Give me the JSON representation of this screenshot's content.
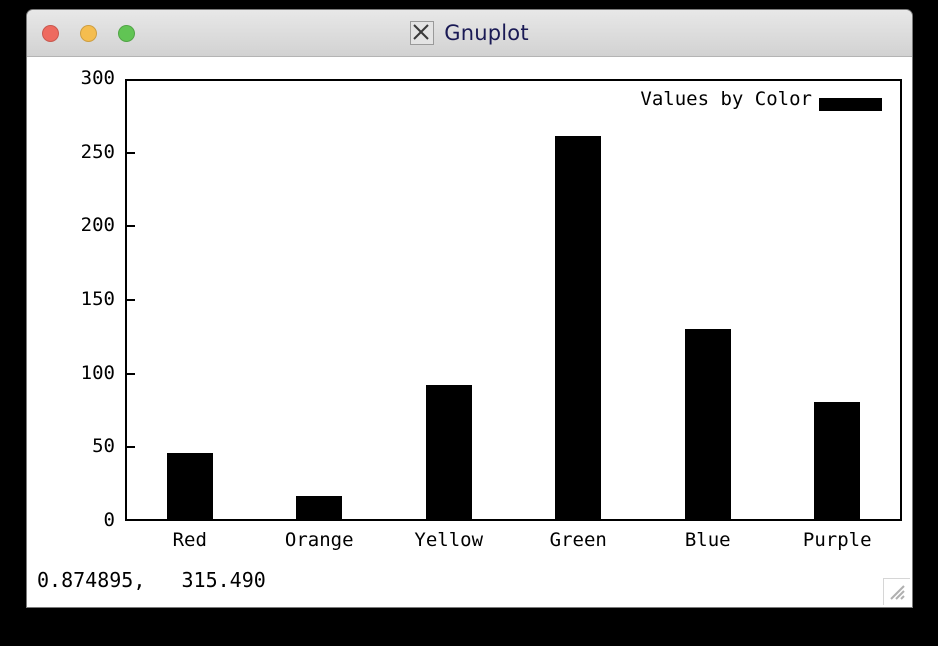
{
  "window": {
    "title": "Gnuplot",
    "app_icon": "x11-icon",
    "controls": {
      "close_label": "close",
      "minimize_label": "minimize",
      "maximize_label": "maximize",
      "close_color": "#ee6a5f",
      "minimize_color": "#f5bd4f",
      "maximize_color": "#61c454"
    }
  },
  "status": {
    "coordinates": "0.874895,   315.490"
  },
  "chart_data": {
    "type": "bar",
    "title": "",
    "categories": [
      "Red",
      "Orange",
      "Yellow",
      "Green",
      "Blue",
      "Purple"
    ],
    "values": [
      46,
      17,
      92,
      261,
      130,
      81
    ],
    "series": [
      {
        "name": "Values by Color",
        "values": [
          46,
          17,
          92,
          261,
          130,
          81
        ],
        "color": "#000000"
      }
    ],
    "xlabel": "",
    "ylabel": "",
    "ylim": [
      0,
      300
    ],
    "yticks": [
      0,
      50,
      100,
      150,
      200,
      250,
      300
    ],
    "ytick_labels": [
      "0",
      "50",
      "100",
      "150",
      "200",
      "250",
      "300"
    ],
    "grid": false,
    "legend": {
      "entries": [
        "Values by Color"
      ],
      "position": "top-right",
      "swatch_color": "#000000"
    },
    "bar_color": "#000000",
    "axis_color": "#000000",
    "background": "#ffffff"
  }
}
